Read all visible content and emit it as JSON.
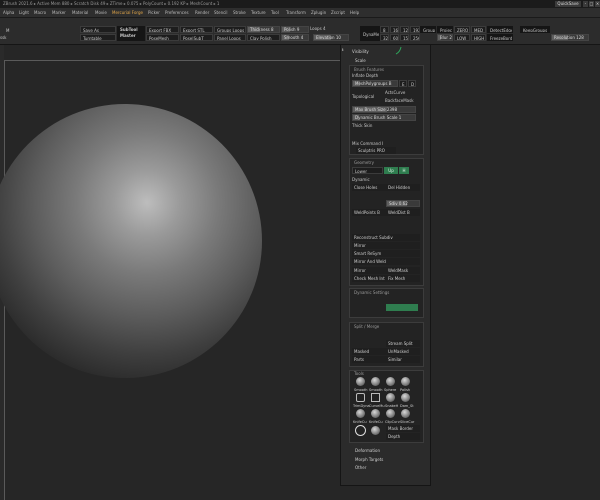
{
  "titlebar": {
    "text": "ZBrush 2021.6 ▸ Active Mem 880 ▸ Scratch Disk 49 ▸ ZTime ▸ 0.075 ▸ PolyCount ▸ 0.192 KP ▸ MeshCount ▸ 1",
    "quicksave": "QuickSave",
    "minimize": "-",
    "maximize": "□",
    "close": "×"
  },
  "menubar": {
    "items": [
      "Alpha",
      "Light",
      "Macro",
      "Marker",
      "Material",
      "Movie",
      "Mercurial Forge",
      "Picker",
      "Preferences",
      "Render",
      "Stencil",
      "Stroke",
      "Texture",
      "Tool",
      "Transform",
      "Zplugin",
      "Zscript",
      "Help"
    ],
    "active_index": 6
  },
  "toolbar": {
    "left_label": "M",
    "left_label2": "ssk",
    "save_as": "Save As",
    "turntable": "Turntable",
    "subtool_master": "SubTool Master",
    "export_fbx": "Export FBX",
    "posemesh": "PoseMesh",
    "export_stl": "Export STL",
    "pose_subt": "Pose|SubT",
    "groups_loops": "Groups Loops",
    "panel_loops": "Panel Loops",
    "thickness": "Thickness 8",
    "clay_polish": "Clay Polish",
    "polish": "Polish 9",
    "smooth": "Smooth 4",
    "loops": "Loops 4",
    "elevation": "Elevation 10",
    "dynamesh": "DynaMesh",
    "res1": [
      "8",
      "16",
      "128",
      "192"
    ],
    "res2": [
      "32",
      "60",
      "152",
      "256"
    ],
    "groups_label": "Groups",
    "project_label": "Project",
    "blur_label": "Blur",
    "blur_val": "2",
    "zero": "ZERO",
    "low": "LOW",
    "med": "MED",
    "high": "HIGH",
    "detect_edges": "DetectEdges",
    "freeze_border": "FreezeBorder",
    "keep_groups": "KeepGroups",
    "resolution": "Resolution 128"
  },
  "panel": {
    "header_icon": "ℹ",
    "visibility": "Visibility",
    "scale": "Scale",
    "brush_features": "Brush Features",
    "inflate_depth": "Inflate Depth",
    "meshpolygroups": "MeshPolygroups B",
    "meshpoly_btn1": "E",
    "meshpoly_btn2": "D",
    "topological": "Topological",
    "actcurve": "ActsCurve",
    "backface_mask": "BackfaceMask",
    "max_brush_size": "Max Brush Size 2398",
    "dynamic_brush_scale": "Dynamic Brush Scale 1",
    "thick_skin": "Thick Skin",
    "mix_command": "Mix Command I",
    "sculptris_pro": "Sculptris PRO",
    "geometry": "Geometry",
    "sdiv_btn1": "Lower",
    "sdiv_btn2": "Up",
    "sdiv_btn3": "H",
    "dynamic": "Dynamic",
    "close_holes": "Close Holes",
    "del_hidden": "Del Hidden",
    "sdiv_label": "Sdiv 0.62",
    "weld_points": "WeldPoints B",
    "weld_dist": "WeldDist B",
    "reconstruct_subdiv": "Reconstruct Subdiv",
    "mirror": "Mirror",
    "smart_resym": "Smart ReSym",
    "mirror_and_weld": "Mirror And Weld",
    "mirror2": "Mirror",
    "weld_mask": "WeldMask",
    "check_mesh_int": "Check Mesh Int",
    "fix_mesh": "Fix Mesh",
    "dynamic_settings": "Dynamic Settings",
    "split_merge": "Split / Merge",
    "stream_split": "Stream Split",
    "masked": "Masked",
    "unmasked": "UnMasked",
    "parts": "Parts",
    "similar": "Similar",
    "tools": "Tools",
    "tool_labels": [
      "Smooth",
      "Smooth",
      "Sphere",
      "Polish",
      "Relax"
    ],
    "tool_labels2": [
      "TrimDyna",
      "CurveMu",
      "SnakeH",
      "Dam_St"
    ],
    "tool_labels3": [
      "KnifeCu",
      "KnifeCu",
      "ClipCurv",
      "SliceCur"
    ],
    "mask_border": "Mask Border",
    "depth": "Depth",
    "deformation": "Deformation",
    "morph_targets": "Morph Targets",
    "other": "Other"
  },
  "colors": {
    "accent": "#e6a94a",
    "green": "#2f7d4f",
    "panel_bg": "#2b2b2b",
    "canvas_bg": "#262626"
  }
}
